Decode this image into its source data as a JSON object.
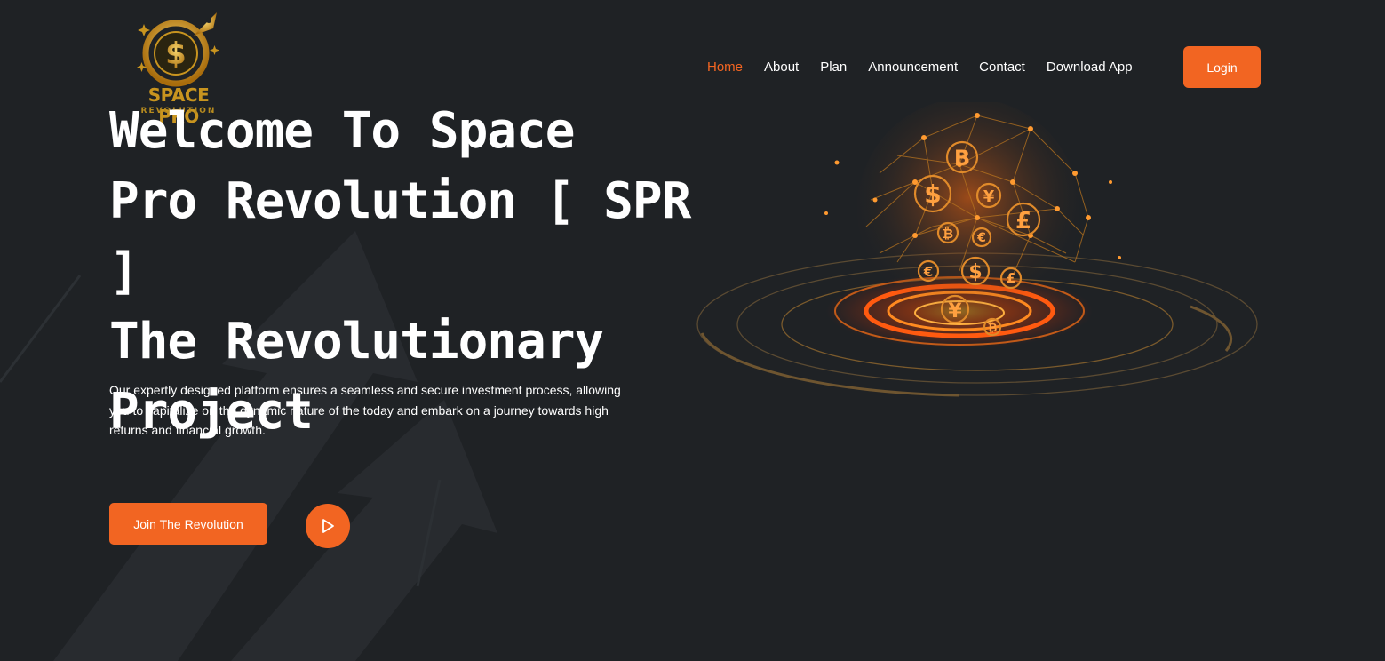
{
  "brand": {
    "name": "SPACE PRO",
    "tagline": "REVOLUTION",
    "logo_icon": "dollar-rocket-icon",
    "gold": "#c8941f"
  },
  "nav": {
    "items": [
      {
        "label": "Home",
        "active": true
      },
      {
        "label": "About",
        "active": false
      },
      {
        "label": "Plan",
        "active": false
      },
      {
        "label": "Announcement",
        "active": false
      },
      {
        "label": "Contact",
        "active": false
      },
      {
        "label": "Download App",
        "active": false
      }
    ],
    "login_label": "Login"
  },
  "hero": {
    "title_lines": [
      "Welcome To Space",
      "Pro Revolution [ SPR ]",
      "The Revolutionary",
      "Project"
    ],
    "description": "Our expertly designed platform ensures a seamless and secure investment process, allowing you to capitalize on the dynamic nature of the today and embark on a journey towards high returns and financial growth.",
    "cta_label": "Join The Revolution",
    "play_icon": "play-icon"
  },
  "theme": {
    "background": "#1f2225",
    "accent": "#f26522",
    "text": "#ffffff"
  },
  "illustration": {
    "icon": "crypto-globe-icon",
    "symbols": [
      "B",
      "$",
      "¥",
      "£",
      "₿",
      "€",
      "$",
      "€",
      "¥",
      "₿",
      "£"
    ]
  }
}
